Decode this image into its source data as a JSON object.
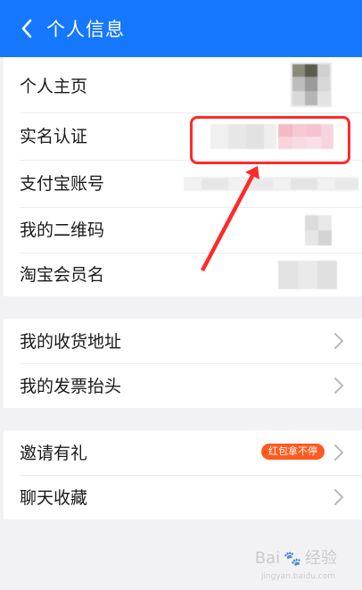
{
  "header": {
    "title": "个人信息",
    "back_icon": "chevron-left-icon",
    "background": "#1677ff"
  },
  "section_profile": {
    "items": [
      {
        "label": "个人主页"
      },
      {
        "label": "实名认证"
      },
      {
        "label": "支付宝账号"
      },
      {
        "label": "我的二维码"
      },
      {
        "label": "淘宝会员名"
      }
    ]
  },
  "section_address": {
    "items": [
      {
        "label": "我的收货地址"
      },
      {
        "label": "我的发票抬头"
      }
    ]
  },
  "section_more": {
    "items": [
      {
        "label": "邀请有礼",
        "badge": "红包拿不停"
      },
      {
        "label": "聊天收藏"
      }
    ]
  },
  "annotation": {
    "box_color": "#ff2a2a",
    "arrow_color": "#ff2a2a"
  },
  "watermark": {
    "brand": "Bai",
    "suffix": "经验",
    "site": "jingyan.baidu.com"
  }
}
